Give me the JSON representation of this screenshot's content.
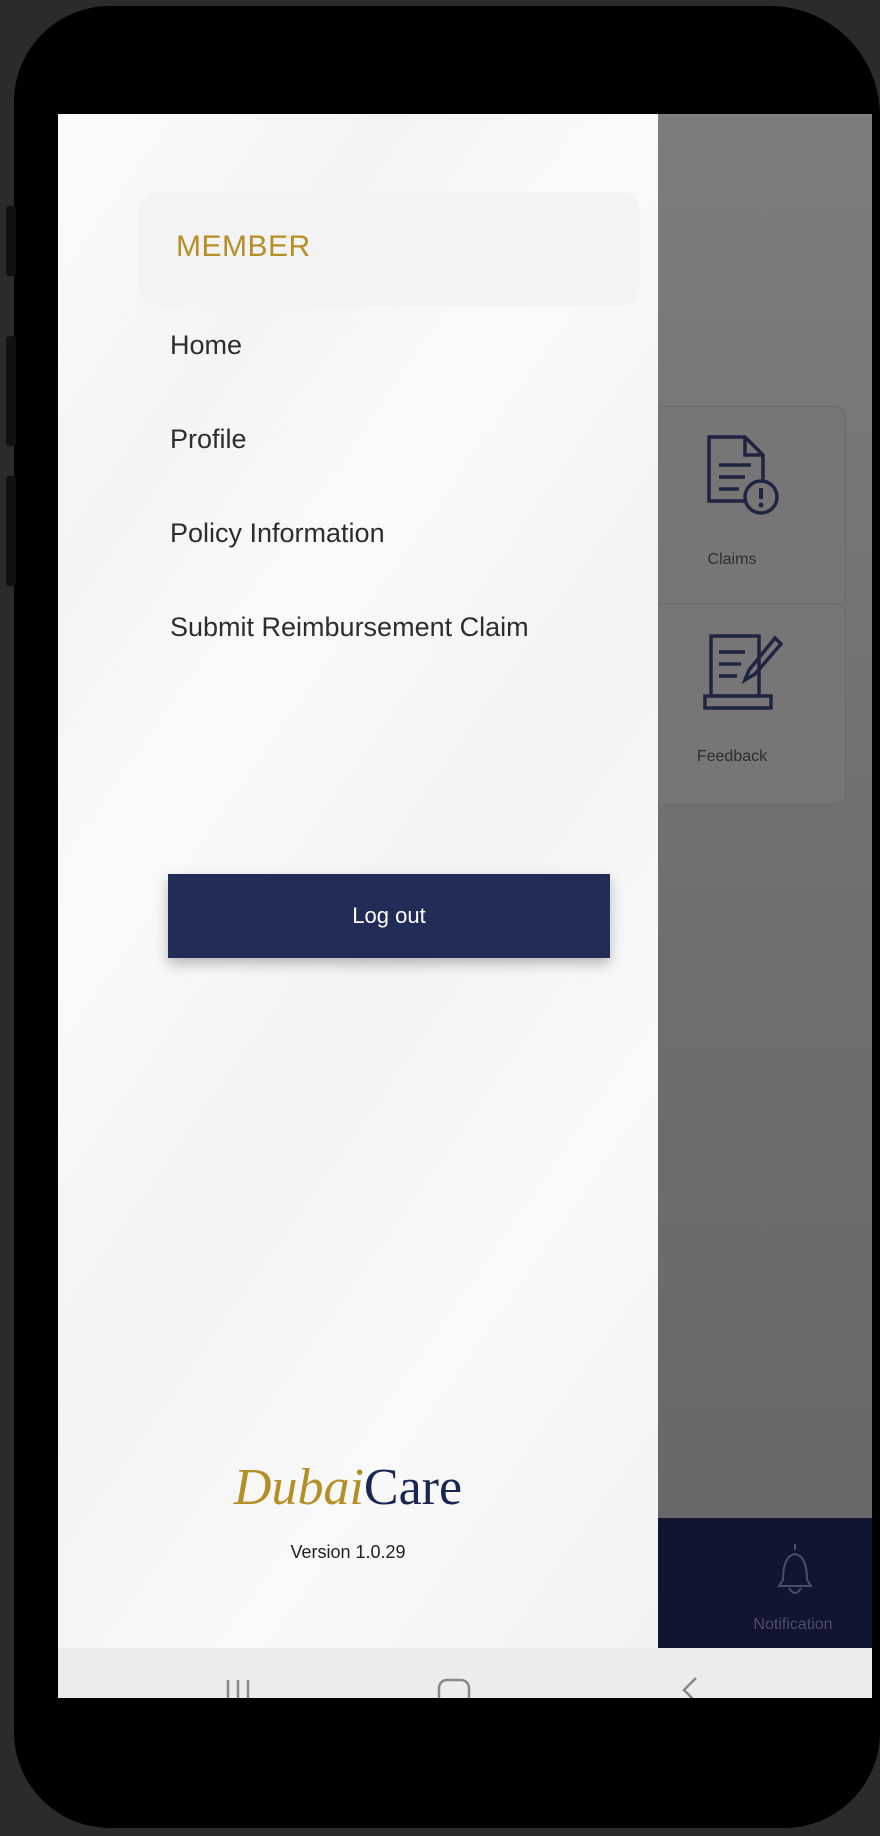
{
  "drawer": {
    "role": "MEMBER",
    "menu": [
      {
        "label": "Home"
      },
      {
        "label": "Profile"
      },
      {
        "label": "Policy Information"
      },
      {
        "label": "Submit Reimbursement Claim"
      }
    ],
    "logout_label": "Log out",
    "logo": {
      "part1": "Dubai",
      "part2": "Care"
    },
    "version": "Version 1.0.29"
  },
  "background_app": {
    "tiles": [
      {
        "label": "Claims",
        "icon": "claims-icon"
      },
      {
        "label": "Feedback",
        "icon": "feedback-icon"
      }
    ],
    "bottom_nav": {
      "label": "Notification",
      "icon": "bell-icon"
    }
  },
  "system_nav": {
    "icons": [
      "recent-apps-icon",
      "home-icon",
      "back-icon"
    ]
  },
  "colors": {
    "accent_gold": "#b48f25",
    "navy": "#222d57",
    "bottom_nav": "#121530"
  }
}
